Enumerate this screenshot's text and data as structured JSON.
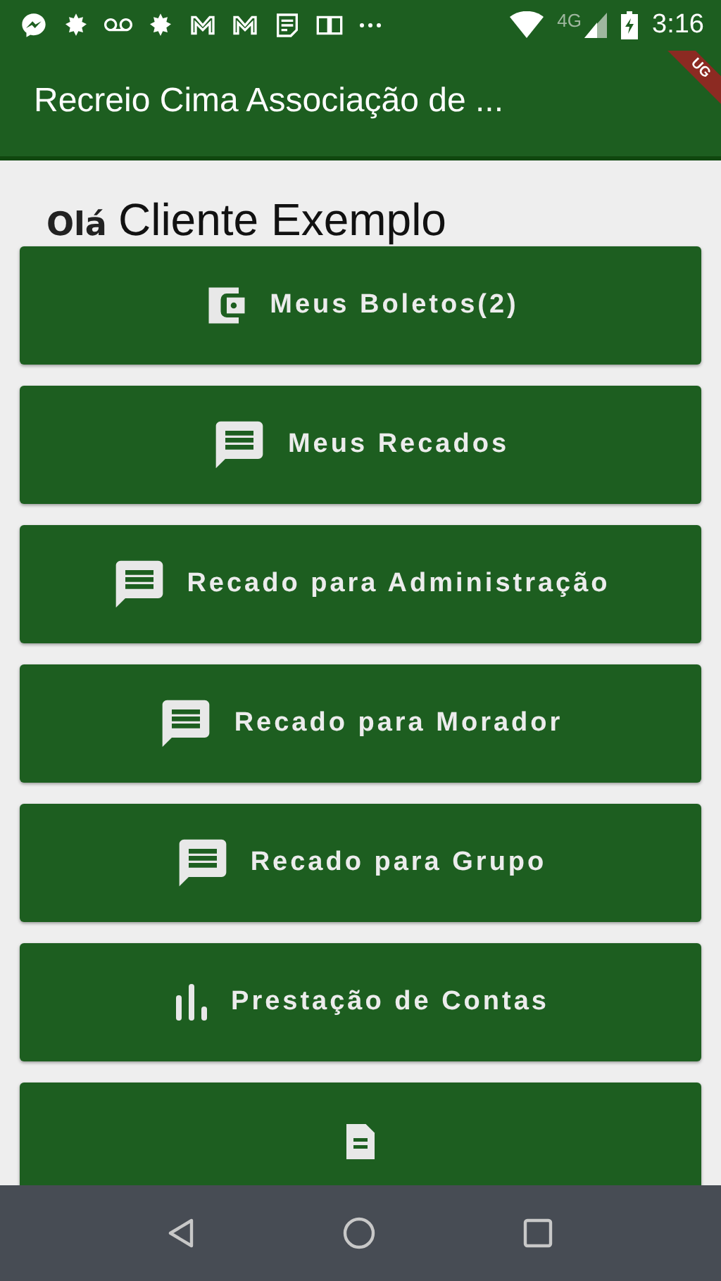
{
  "status_bar": {
    "network": "4G",
    "time": "3:16"
  },
  "app_bar": {
    "title": "Recreio Cima Associação de ...",
    "debug_banner": "UG"
  },
  "greeting": {
    "salutation": "Olá",
    "name": "Cliente Exemplo"
  },
  "menu_buttons": [
    {
      "kind": "wallet",
      "label": "Meus Boletos(2)"
    },
    {
      "kind": "message",
      "label": "Meus Recados"
    },
    {
      "kind": "message",
      "label": "Recado para Administração"
    },
    {
      "kind": "message",
      "label": "Recado para Morador"
    },
    {
      "kind": "message",
      "label": "Recado para Grupo"
    },
    {
      "kind": "chart",
      "label": "Prestação de Contas"
    },
    {
      "kind": "document"
    }
  ]
}
